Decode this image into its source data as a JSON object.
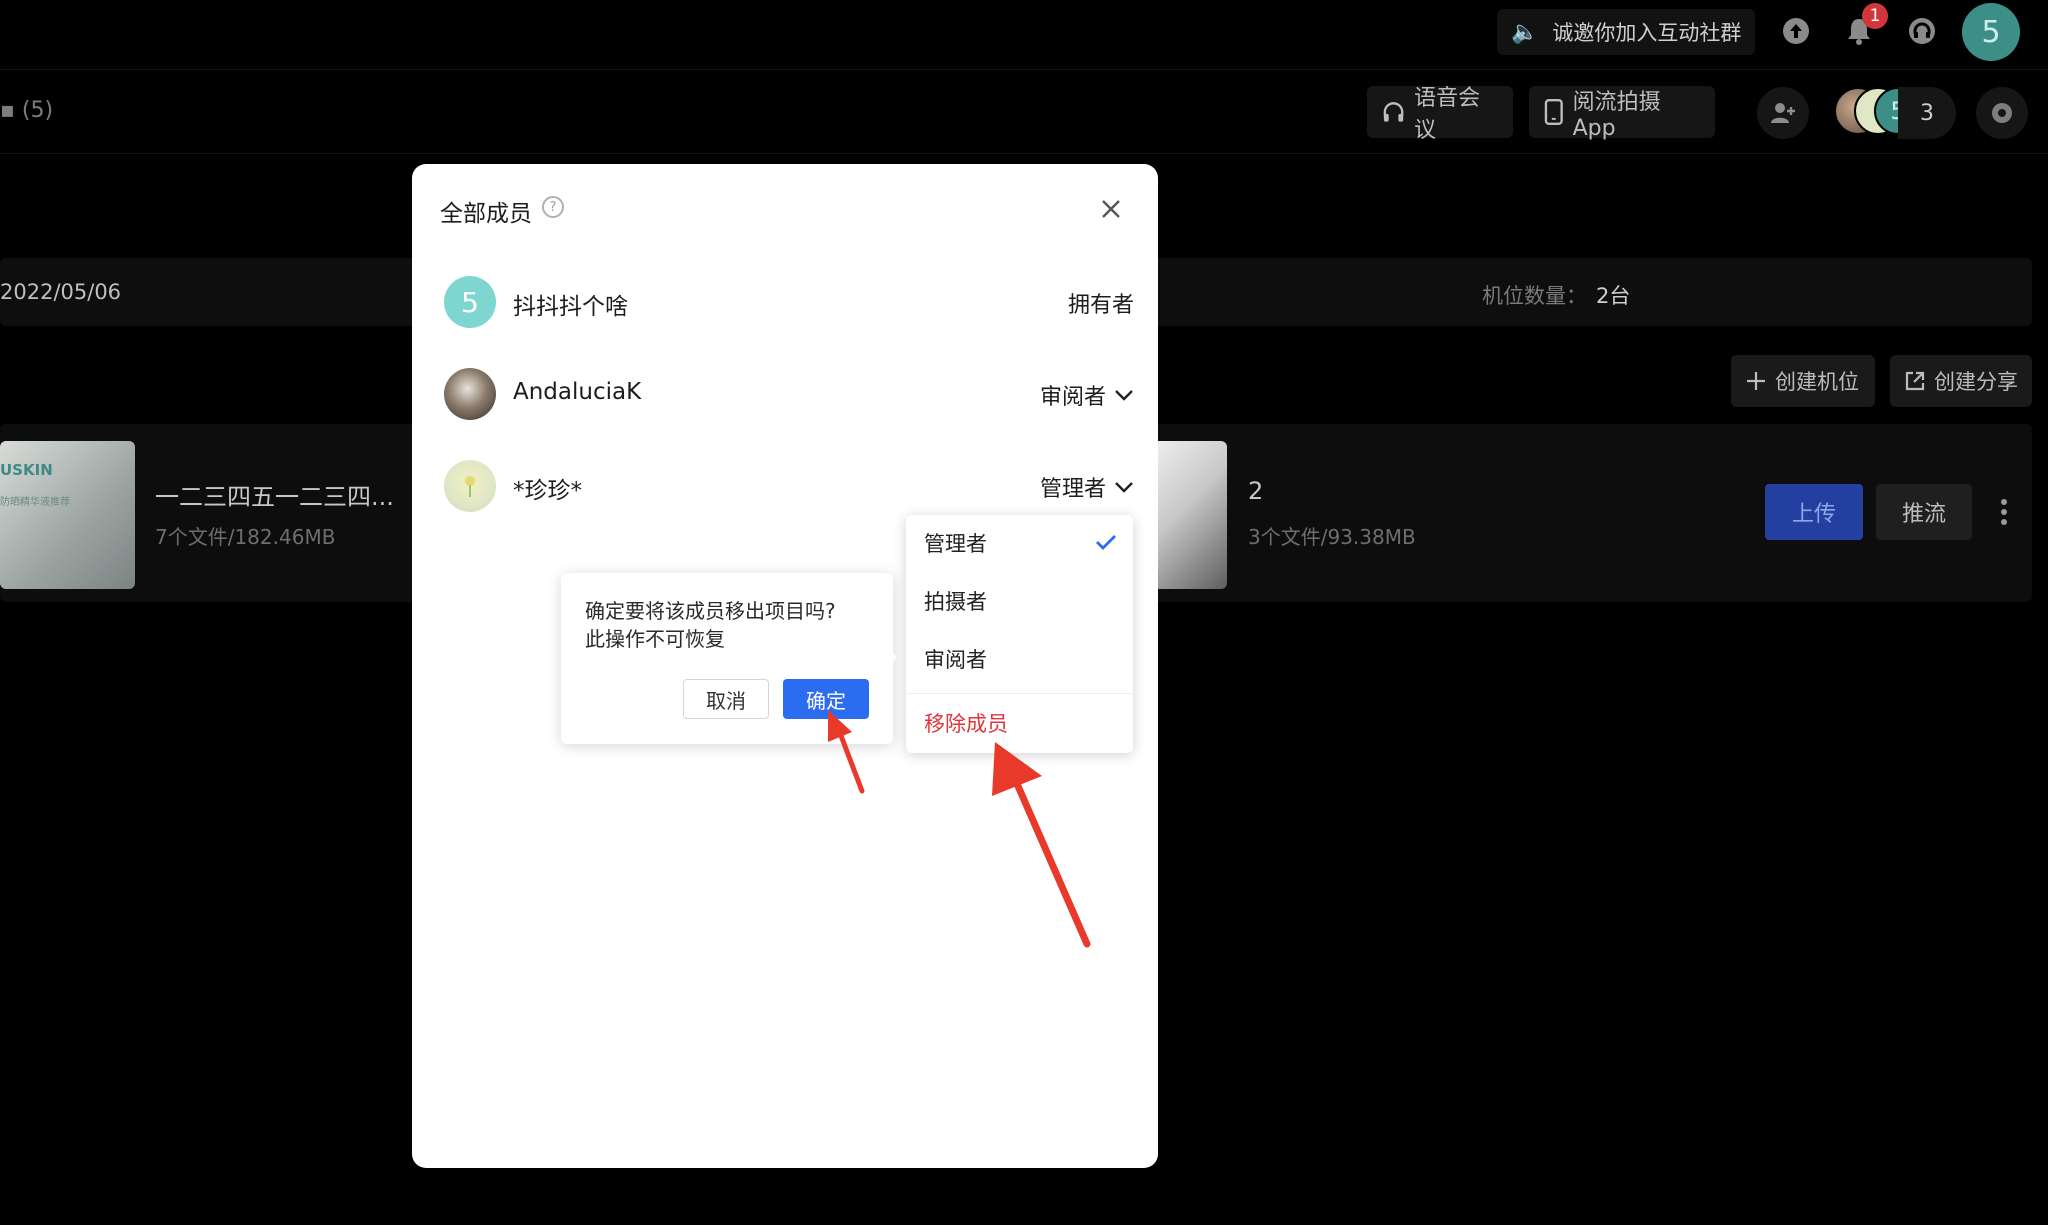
{
  "topbar": {
    "invite_label": "诚邀你加入互动社群",
    "notification_count": "1",
    "user_avatar_letter": "5"
  },
  "subbar": {
    "breadcrumb": "▪ (5)",
    "voice_meeting": "语音会议",
    "app_label": "阅流拍摄App",
    "member_count": "3",
    "avatar_letter": "5"
  },
  "project_info": {
    "date": "2022/05/06",
    "seat_label": "机位数量：",
    "seat_value": "2台"
  },
  "actions": {
    "create_seat": "创建机位",
    "create_share": "创建分享"
  },
  "cards": [
    {
      "title": "一二三四五一二三四...",
      "meta": "7个文件/182.46MB",
      "thumb_brand": "USKIN",
      "thumb_caption": "防晒精华液推荐"
    },
    {
      "title": "2",
      "meta": "3个文件/93.38MB"
    }
  ],
  "card_actions": {
    "upload": "上传",
    "push": "推流"
  },
  "modal": {
    "title": "全部成员",
    "members": [
      {
        "name": "抖抖抖个啥",
        "role": "拥有者",
        "avatar_letter": "5",
        "avatar_color": "#7fd6d0"
      },
      {
        "name": "AndaluciaK",
        "role": "审阅者"
      },
      {
        "name": "*珍珍*",
        "role": "管理者"
      }
    ]
  },
  "role_dropdown": {
    "items": [
      {
        "label": "管理者",
        "selected": true
      },
      {
        "label": "拍摄者"
      },
      {
        "label": "审阅者"
      },
      {
        "label": "移除成员",
        "danger": true
      }
    ]
  },
  "popconfirm": {
    "line1": "确定要将该成员移出项目吗?",
    "line2": "此操作不可恢复",
    "cancel": "取消",
    "ok": "确定"
  },
  "colors": {
    "primary": "#2b6cf0",
    "danger": "#e0353c",
    "annotation_arrow": "#e8392a"
  }
}
